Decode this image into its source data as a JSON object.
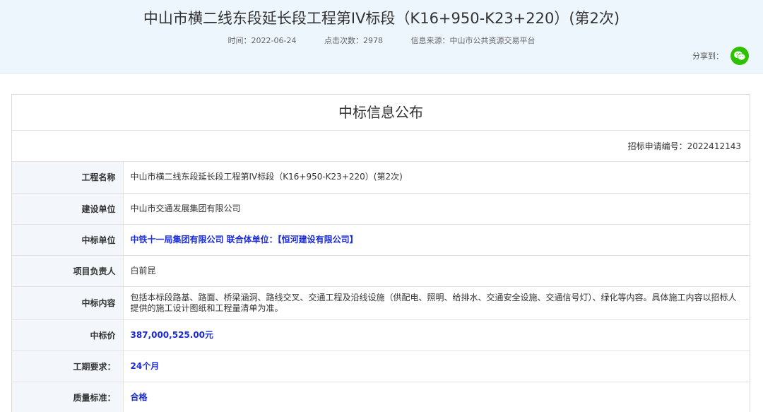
{
  "header": {
    "title": "中山市横二线东段延长段工程第IV标段（K16+950-K23+220）(第2次)",
    "time": "时间：2022-06-24",
    "clicks": "点击次数：2978",
    "source": "信息来源：中山市公共资源交易平台",
    "share_label": "分享到：",
    "share_icon": "wechat-icon"
  },
  "panel": {
    "title": "中标信息公布",
    "code": "招标申请编号：2022412143",
    "rows": [
      {
        "key": "工程名称",
        "value": "中山市横二线东段延长段工程第IV标段（K16+950-K23+220）(第2次)"
      },
      {
        "key": "建设单位",
        "value": "中山市交通发展集团有限公司"
      },
      {
        "key": "中标单位",
        "value": "中铁十一局集团有限公司 联合体单位：【恒河建设有限公司】"
      },
      {
        "key": "项目负责人",
        "value": "白前昆"
      },
      {
        "key": "中标内容",
        "value": "包括本标段路基、路面、桥梁涵洞、路线交叉、交通工程及沿线设施（供配电、照明、给排水、交通安全设施、交通信号灯）、绿化等内容。具体施工内容以招标人提供的施工设计图纸和工程量清单为准。"
      },
      {
        "key": "中标价",
        "value": "387,000,525.00元"
      },
      {
        "key": "工期要求：",
        "value": "24个月"
      },
      {
        "key": "质量标准：",
        "value": "合格"
      }
    ]
  },
  "colors": {
    "header_bg": "#eef6fd",
    "key_bg": "#f3f7fc",
    "highlight": "#1a2bd6",
    "wechat": "#2dc100"
  }
}
